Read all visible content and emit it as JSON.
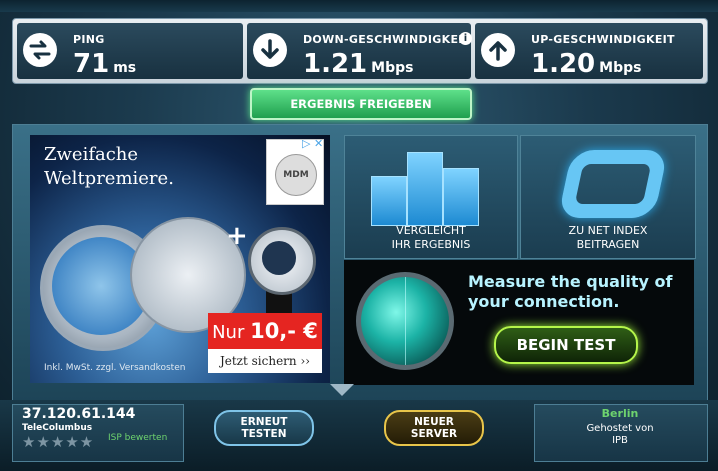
{
  "stats": {
    "ping": {
      "label": "PING",
      "value": "71",
      "unit": "ms",
      "icon": "ping-arrows-icon"
    },
    "download": {
      "label": "DOWN-GESCHWINDIGKEIT",
      "value": "1.21",
      "unit": "Mbps",
      "icon": "download-arrow-icon",
      "info": "i"
    },
    "upload": {
      "label": "UP-GESCHWINDIGKEIT",
      "value": "1.20",
      "unit": "Mbps",
      "icon": "upload-arrow-icon"
    }
  },
  "share_button": "ERGEBNIS FREIGEBEN",
  "ad": {
    "title": "Zweifache\nWeltpremiere.",
    "logo_text": "MDM",
    "adchoices": "▷ ✕",
    "price_prefix": "Nur ",
    "price_value": "10,- €",
    "cta": "Jetzt sichern ››",
    "fine_print": "Inkl. MwSt. zzgl. Versandkosten"
  },
  "tiles": {
    "compare": "VERGLEICHT\nIHR ERGEBNIS",
    "netindex": "ZU NET INDEX\nBEITRAGEN"
  },
  "test_promo": {
    "text": "Measure the quality of\nyour connection.",
    "button": "BEGIN TEST"
  },
  "isp": {
    "ip": "37.120.61.144",
    "name": "TeleColumbus",
    "stars": "★★★★★",
    "rate_link": "ISP bewerten"
  },
  "buttons": {
    "retest": "ERNEUT\nTESTEN",
    "new_server": "NEUER\nSERVER"
  },
  "server": {
    "city": "Berlin",
    "host": "Gehostet von\nIPB"
  },
  "colors": {
    "accent_green": "#59e38a",
    "begin_test_border": "#b5f54a",
    "isp_link": "#6ed36e",
    "price_red": "#e52521"
  }
}
